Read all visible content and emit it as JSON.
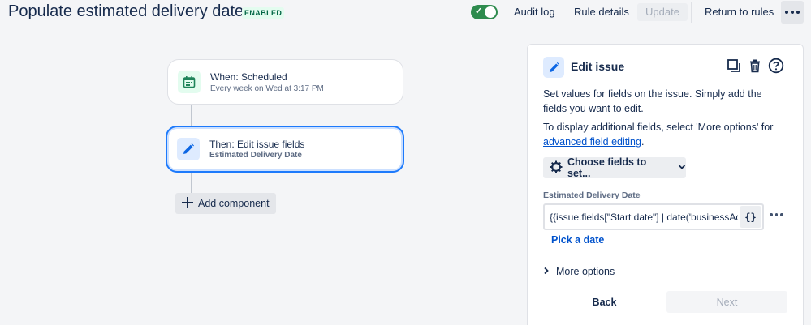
{
  "header": {
    "title": "Populate estimated delivery date",
    "status": "ENABLED",
    "enabled": true,
    "audit_log": "Audit log",
    "rule_details": "Rule details",
    "update": "Update",
    "return_to_rules": "Return to rules"
  },
  "canvas": {
    "trigger": {
      "title": "When: Scheduled",
      "subtitle": "Every week on Wed at 3:17 PM",
      "icon": "calendar-icon"
    },
    "action": {
      "title": "Then: Edit issue fields",
      "subtitle": "Estimated Delivery Date",
      "icon": "pencil-icon"
    },
    "add_component": "Add component"
  },
  "panel": {
    "title": "Edit issue",
    "description": "Set values for fields on the issue. Simply add the fields you want to edit.",
    "additional_text": "To display additional fields, select 'More options' for",
    "advanced_link": "advanced field editing",
    "period": ".",
    "choose_fields": "Choose fields to set...",
    "field_label": "Estimated Delivery Date",
    "field_value": "{{issue.fields[\"Start date\"] | date('businessAdd",
    "smart_value_button": "{}",
    "pick_date": "Pick a date",
    "more_options": "More options",
    "back": "Back",
    "next": "Next"
  },
  "colors": {
    "accent": "#0052cc",
    "enabled_green": "#2e8b4e",
    "trigger_icon_bg": "#e3fcef",
    "action_icon_bg": "#deebff",
    "selected_border": "#4c9aff"
  }
}
